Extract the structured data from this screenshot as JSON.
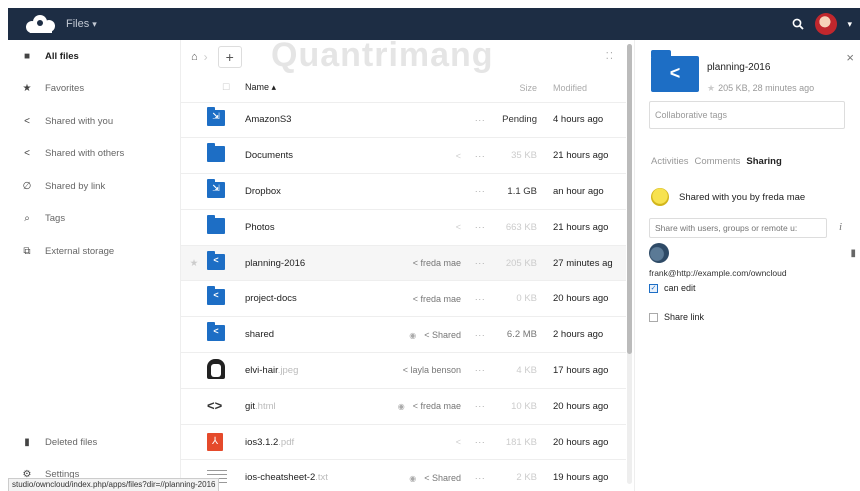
{
  "header": {
    "app_name": "Files",
    "app_caret": "▾",
    "user_caret": "▾"
  },
  "watermark": "Quantrimang",
  "sidebar": {
    "items": [
      {
        "label": "All files",
        "icon": "folder-icon",
        "glyph": "■",
        "active": true
      },
      {
        "label": "Favorites",
        "icon": "star-icon",
        "glyph": "★"
      },
      {
        "label": "Shared with you",
        "icon": "share-icon",
        "glyph": "<"
      },
      {
        "label": "Shared with others",
        "icon": "share-icon",
        "glyph": "<"
      },
      {
        "label": "Shared by link",
        "icon": "link-icon",
        "glyph": "∅"
      },
      {
        "label": "Tags",
        "icon": "tag-icon",
        "glyph": "⌕"
      },
      {
        "label": "External storage",
        "icon": "external-storage-icon",
        "glyph": "⧉"
      }
    ],
    "bottom": [
      {
        "label": "Deleted files",
        "icon": "trash-icon",
        "glyph": "▮"
      },
      {
        "label": "Settings",
        "icon": "gear-icon",
        "glyph": "⚙"
      }
    ]
  },
  "controls": {
    "home_glyph": "⌂",
    "sep_glyph": "›",
    "new_label": "+",
    "view_glyph": "⁚⁚"
  },
  "table": {
    "headers": {
      "name": "Name ▴",
      "size": "Size",
      "modified": "Modified"
    },
    "rows": [
      {
        "name": "AmazonS3",
        "ext": "",
        "icon": "external-folder-icon",
        "type": "folder",
        "glyph": "⇲",
        "share": "",
        "comment": false,
        "size": "Pending",
        "size_style": "dark",
        "modified": "4 hours ago"
      },
      {
        "name": "Documents",
        "ext": "",
        "icon": "folder-icon",
        "type": "folder",
        "glyph": "",
        "share": "<",
        "comment": false,
        "size": "35 KB",
        "size_style": "light",
        "modified": "21 hours ago"
      },
      {
        "name": "Dropbox",
        "ext": "",
        "icon": "external-folder-icon",
        "type": "folder",
        "glyph": "⇲",
        "share": "",
        "comment": false,
        "size": "1.1 GB",
        "size_style": "dark",
        "modified": "an hour ago"
      },
      {
        "name": "Photos",
        "ext": "",
        "icon": "folder-icon",
        "type": "folder",
        "glyph": "",
        "share": "<",
        "comment": false,
        "size": "663 KB",
        "size_style": "light",
        "modified": "21 hours ago"
      },
      {
        "name": "planning-2016",
        "ext": "",
        "icon": "shared-folder-icon",
        "type": "folder",
        "glyph": "<",
        "share": "< freda mae",
        "comment": false,
        "size": "205 KB",
        "size_style": "light",
        "modified": "27 minutes ag",
        "selected": true
      },
      {
        "name": "project-docs",
        "ext": "",
        "icon": "shared-folder-icon",
        "type": "folder",
        "glyph": "<",
        "share": "< freda mae",
        "comment": false,
        "size": "0 KB",
        "size_style": "light",
        "modified": "20 hours ago"
      },
      {
        "name": "shared",
        "ext": "",
        "icon": "shared-folder-icon",
        "type": "folder",
        "glyph": "<",
        "share": "< Shared",
        "comment": true,
        "size": "6.2 MB",
        "size_style": "normal",
        "modified": "2 hours ago"
      },
      {
        "name": "elvi-hair",
        "ext": ".jpeg",
        "icon": "image-thumbnail-icon",
        "type": "hair",
        "glyph": "",
        "share": "< layla benson",
        "comment": false,
        "size": "4 KB",
        "size_style": "light",
        "modified": "17 hours ago"
      },
      {
        "name": "git",
        "ext": ".html",
        "icon": "code-icon",
        "type": "code",
        "glyph": "<>",
        "share": "< freda mae",
        "comment": true,
        "size": "10 KB",
        "size_style": "light",
        "modified": "20 hours ago"
      },
      {
        "name": "ios3.1.2",
        "ext": ".pdf",
        "icon": "pdf-icon",
        "type": "pdf",
        "glyph": "⅄",
        "share": "<",
        "comment": false,
        "size": "181 KB",
        "size_style": "light",
        "modified": "20 hours ago"
      },
      {
        "name": "ios-cheatsheet-2",
        "ext": ".txt",
        "icon": "text-thumbnail-icon",
        "type": "thumb",
        "glyph": "",
        "share": "< Shared",
        "comment": true,
        "size": "2 KB",
        "size_style": "light",
        "modified": "19 hours ago"
      }
    ],
    "dots": "···",
    "star": "★"
  },
  "details": {
    "close": "×",
    "name": "planning-2016",
    "meta": "205 KB, 28 minutes ago",
    "meta_star": "★",
    "tags_placeholder": "Collaborative tags",
    "tabs": [
      "Activities",
      "Comments",
      "Sharing"
    ],
    "active_tab": 2,
    "shared_by": "Shared with you by freda mae",
    "share_input_placeholder": "Share with users, groups or remote u:",
    "info": "i",
    "sharee": "frank@http://example.com/owncloud",
    "can_edit_label": "can edit",
    "can_edit_checked": true,
    "share_link_label": "Share link",
    "share_link_checked": false,
    "trash": "▮"
  },
  "status_url": "studio/owncloud/index.php/apps/files?dir=//planning-2016",
  "colors": {
    "header_bg": "#1d2d44",
    "folder": "#1d6ec5",
    "pdf": "#e54a2b"
  }
}
